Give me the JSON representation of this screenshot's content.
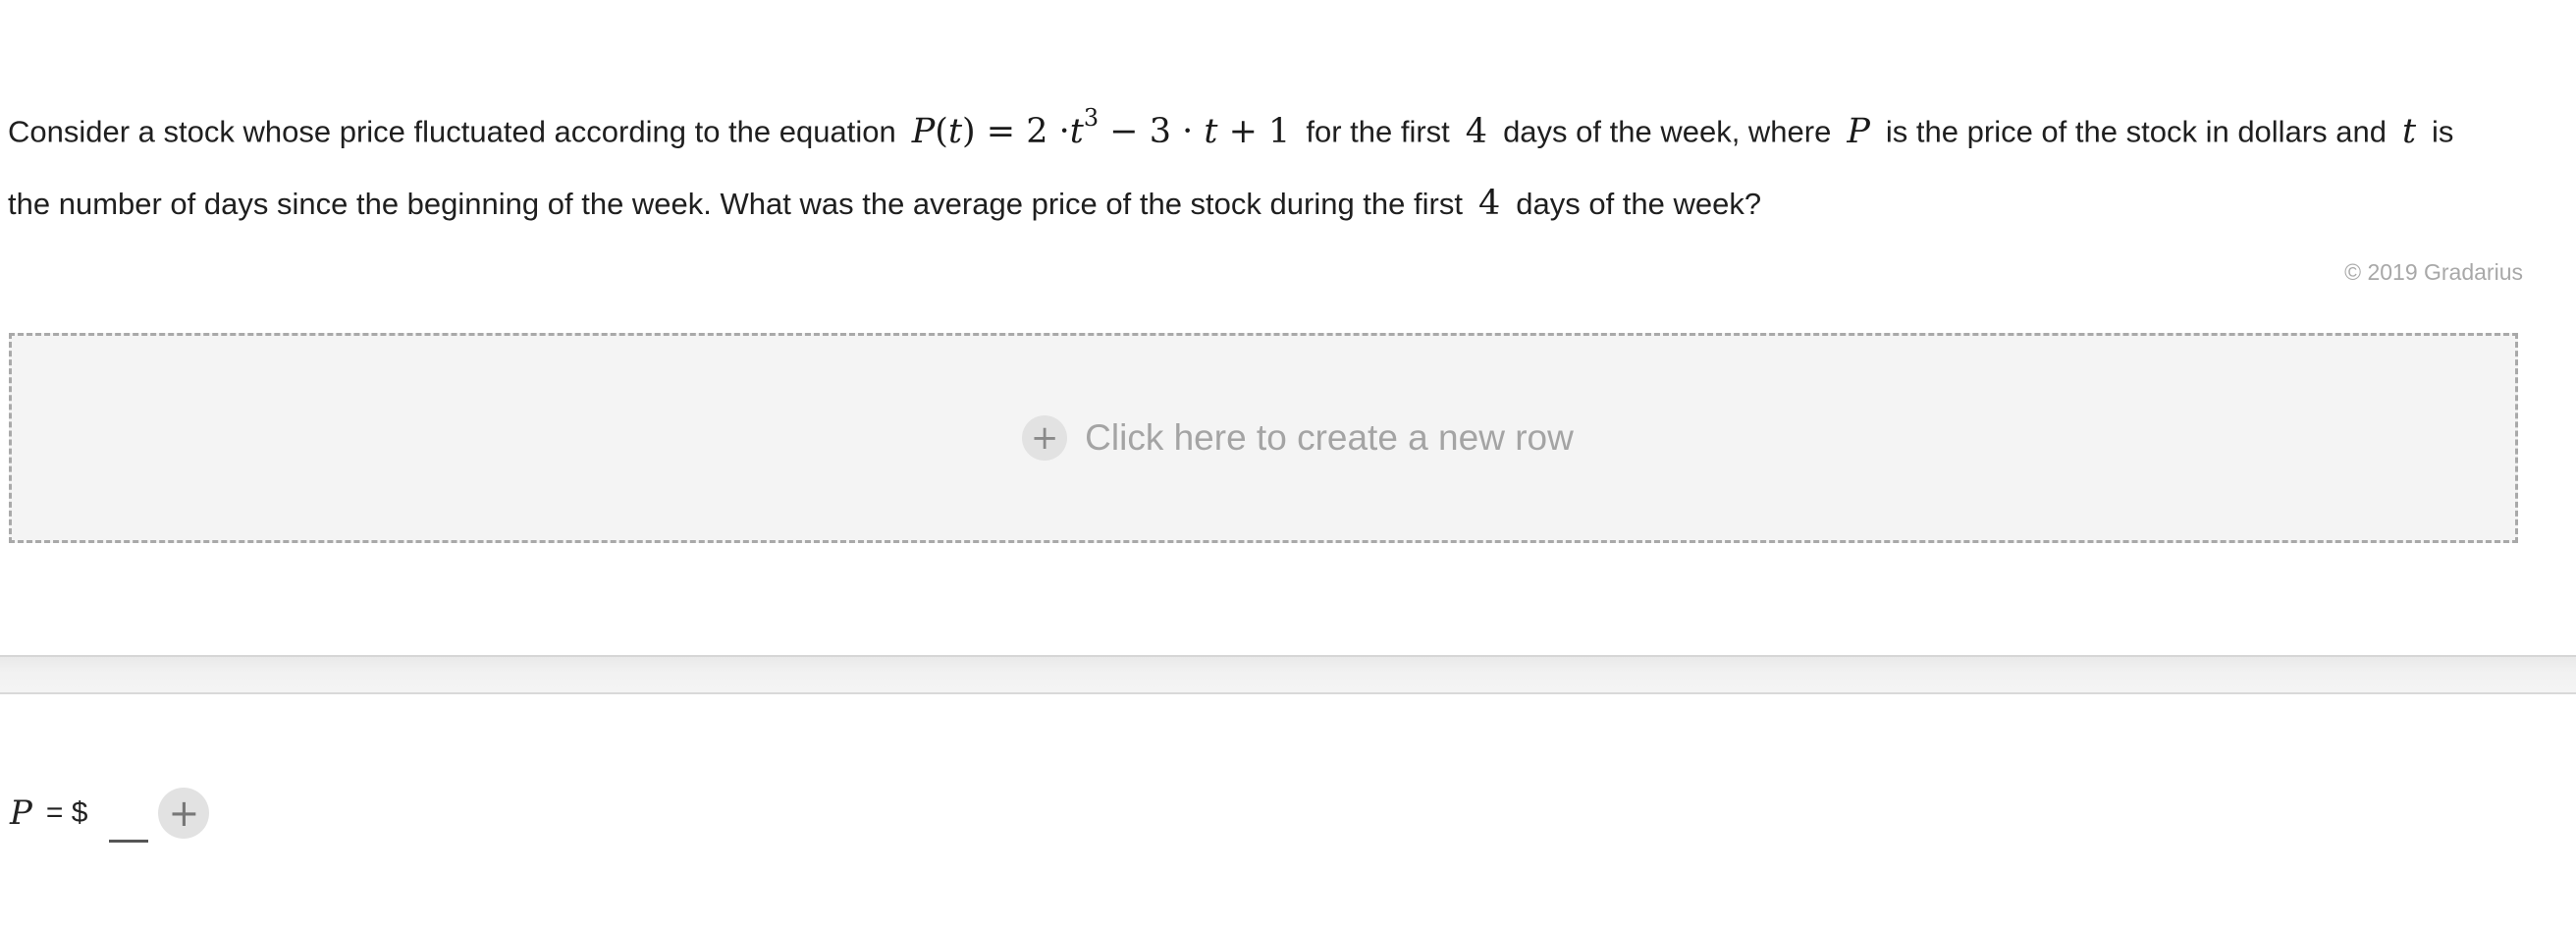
{
  "question": {
    "line1": {
      "t1": "Consider a stock whose price fluctuated according to the equation",
      "eq_P": "P",
      "eq_open": "(",
      "eq_t": "t",
      "eq_mid": ") = 2 ·",
      "eq_t2": "t",
      "eq_exp": "3",
      "eq_tail1": " − 3 ·",
      "eq_t3": "t",
      "eq_tail2": "+ 1",
      "t2": "for the first",
      "n1": "4",
      "t3": "days of the week, where",
      "var_P": "P",
      "t4": "is the price of the stock in dollars and",
      "var_t": "t",
      "t5": "is"
    },
    "line2": {
      "t1": "the number of days since the beginning of the week. What was the average price of the stock during the first",
      "n2": "4",
      "t2": "days of the week?"
    }
  },
  "copyright": "© 2019 Gradarius",
  "new_row": {
    "icon": "plus-icon",
    "label": "Click here to create a new row"
  },
  "answer": {
    "var": "P",
    "eq": "= $",
    "add_icon": "plus-icon"
  }
}
